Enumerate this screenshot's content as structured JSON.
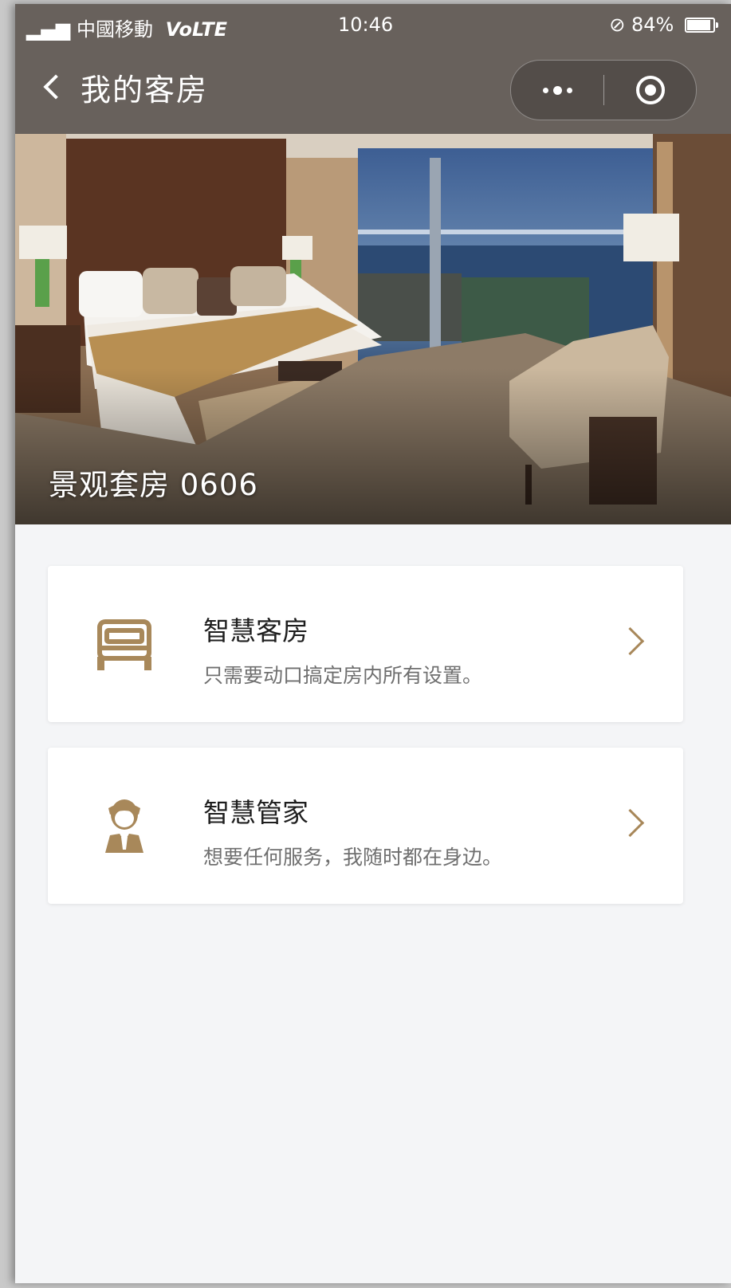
{
  "status_bar": {
    "carrier": "中國移動",
    "network": "VoLTE",
    "time": "10:46",
    "battery": "84%"
  },
  "nav": {
    "title": "我的客房"
  },
  "hero": {
    "room_title": "景观套房 0606"
  },
  "cards": [
    {
      "title": "智慧客房",
      "subtitle": "只需要动口搞定房内所有设置。",
      "icon": "bed-icon"
    },
    {
      "title": "智慧管家",
      "subtitle": "想要任何服务，我随时都在身边。",
      "icon": "butler-icon"
    }
  ],
  "colors": {
    "nav_bg": "#68615c",
    "accent_gold": "#a8885a",
    "page_bg": "#f4f5f7"
  }
}
